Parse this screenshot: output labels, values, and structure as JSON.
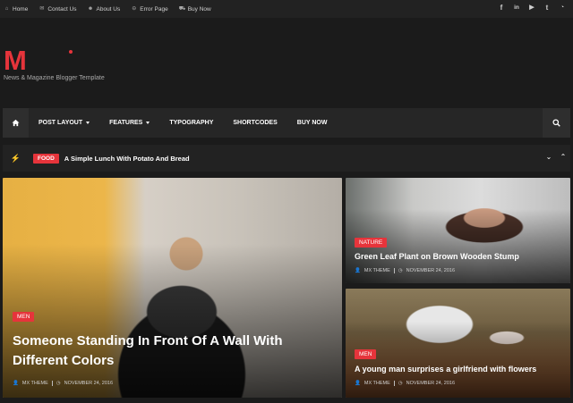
{
  "topnav": [
    {
      "icon": "home-icon",
      "glyph": "⌂",
      "label": "Home"
    },
    {
      "icon": "envelope-icon",
      "glyph": "✉",
      "label": "Contact Us"
    },
    {
      "icon": "users-icon",
      "glyph": "☻",
      "label": "About Us"
    },
    {
      "icon": "minus-circle-icon",
      "glyph": "⊖",
      "label": "Error Page"
    },
    {
      "icon": "cart-icon",
      "glyph": "⛟",
      "label": "Buy Now"
    }
  ],
  "social": [
    {
      "icon": "facebook-icon",
      "glyph": "f"
    },
    {
      "icon": "linkedin-icon",
      "glyph": "in"
    },
    {
      "icon": "youtube-icon",
      "glyph": "▶"
    },
    {
      "icon": "twitter-icon",
      "glyph": "t"
    },
    {
      "icon": "rss-icon",
      "glyph": "◔"
    }
  ],
  "header": {
    "logo": "M",
    "tagline": "News & Magazine Blogger Template"
  },
  "mainnav": {
    "items": [
      {
        "label": "POST LAYOUT",
        "dropdown": true
      },
      {
        "label": "FEATURES",
        "dropdown": true
      },
      {
        "label": "TYPOGRAPHY",
        "dropdown": false
      },
      {
        "label": "SHORTCODES",
        "dropdown": false
      },
      {
        "label": "BUY NOW",
        "dropdown": false
      }
    ]
  },
  "ticker": {
    "badge": "FOOD",
    "title": "A Simple Lunch With Potato And Bread"
  },
  "posts": {
    "big": {
      "category": "MEN",
      "title": "Someone Standing In Front Of A Wall With Different Colors",
      "author": "MX THEME",
      "date": "NOVEMBER 24, 2016"
    },
    "right1": {
      "category": "NATURE",
      "title": "Green Leaf Plant on Brown Wooden Stump",
      "author": "MX THEME",
      "date": "NOVEMBER 24, 2016"
    },
    "right2": {
      "category": "MEN",
      "title": "A young man surprises a girlfriend with flowers",
      "author": "MX THEME",
      "date": "NOVEMBER 24, 2016"
    }
  },
  "colors": {
    "accent": "#e6343b",
    "background": "#1b1b1b",
    "bar": "#262626"
  }
}
